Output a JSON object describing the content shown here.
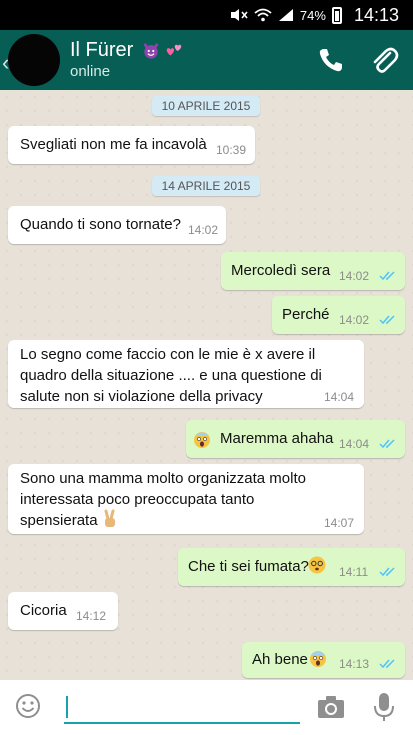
{
  "status_bar": {
    "battery": "74%",
    "time": "14:13"
  },
  "header": {
    "contact_name": "Il Fürer",
    "presence": "online"
  },
  "messages": [
    {
      "type": "date",
      "text": "10 APRILE 2015"
    },
    {
      "type": "in",
      "text": "Svegliati non me fa incavolà",
      "time": "10:39"
    },
    {
      "type": "date",
      "text": "14 APRILE 2015"
    },
    {
      "type": "in",
      "text": "Quando ti sono tornate?",
      "time": "14:02"
    },
    {
      "type": "out",
      "text": "Mercoledì sera",
      "time": "14:02"
    },
    {
      "type": "out",
      "text": "Perché",
      "time": "14:02"
    },
    {
      "type": "in",
      "lines": [
        "Lo segno come faccio con le mie è x avere il",
        "quadro della situazione .... e una questione di",
        "salute non si violazione della privacy"
      ],
      "time": "14:04"
    },
    {
      "type": "out",
      "text": "Maremma ahaha",
      "time": "14:04"
    },
    {
      "type": "in",
      "lines": [
        "Sono una mamma molto organizzata molto",
        "interessata poco preoccupata tanto",
        "spensierata"
      ],
      "time": "14:07"
    },
    {
      "type": "out",
      "text": "Che ti sei fumata?",
      "time": "14:11"
    },
    {
      "type": "in",
      "text": "Cicoria",
      "time": "14:12"
    },
    {
      "type": "out",
      "text": "Ah bene",
      "time": "14:13"
    }
  ],
  "input": {
    "placeholder": ""
  },
  "icons": {
    "avatar_emojis": [
      "smiling-devil-emoji",
      "two-hearts-emoji"
    ],
    "emojis": [
      "scream-emoji",
      "victory-hand-emoji",
      "dizzy-face-emoji"
    ]
  },
  "colors": {
    "header": "#075e54",
    "outgoing": "#dcf8c6",
    "incoming": "#ffffff",
    "ticks": "#4fc3f7"
  }
}
